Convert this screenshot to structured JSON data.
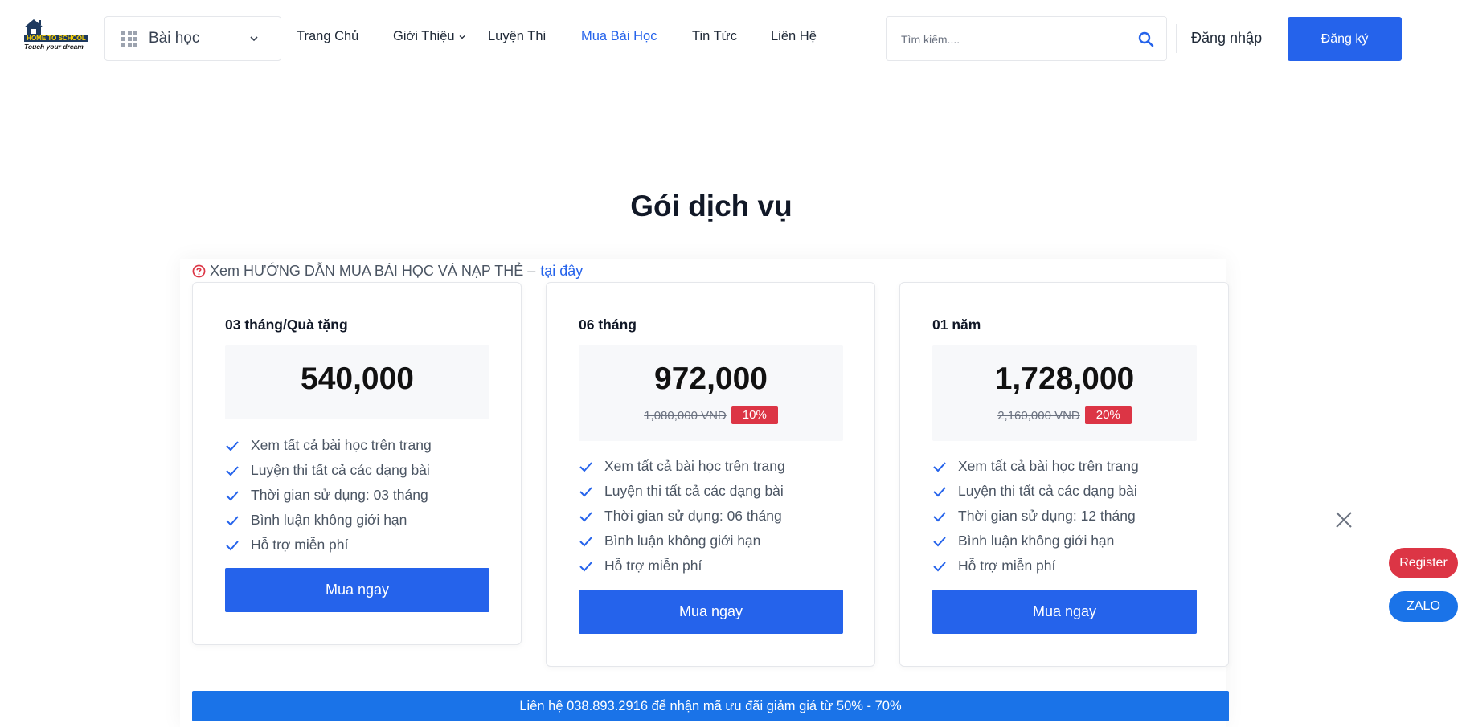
{
  "brand": {
    "logo_line1": "HOME TO SCHOOL",
    "logo_line2": "Touch your dream",
    "logo_icon": "house-icon"
  },
  "header": {
    "category_label": "Bài học",
    "nav": [
      {
        "label": "Trang Chủ",
        "active": false
      },
      {
        "label": "Giới Thiệu",
        "active": false,
        "has_dropdown": true
      },
      {
        "label": "Luyện Thi",
        "active": false
      },
      {
        "label": "Mua Bài Học",
        "active": true
      },
      {
        "label": "Tin Tức",
        "active": false
      },
      {
        "label": "Liên Hệ",
        "active": false
      }
    ],
    "search_placeholder": "Tìm kiếm....",
    "login_label": "Đăng nhập",
    "register_label": "Đăng ký"
  },
  "main": {
    "title": "Gói dịch vụ",
    "guide_text": "Xem HƯỚNG DẪN MUA BÀI HỌC VÀ NẠP THẺ –",
    "guide_link": "tại đây",
    "plans": [
      {
        "title": "03 tháng/Quà tặng",
        "price": "540,000",
        "old_price": "",
        "discount": "",
        "features": [
          "Xem tất cả bài học trên trang",
          "Luyện thi tất cả các dạng bài",
          "Thời gian sử dụng: 03 tháng",
          "Bình luận không giới hạn",
          "Hỗ trợ miễn phí"
        ],
        "button": "Mua ngay"
      },
      {
        "title": "06 tháng",
        "price": "972,000",
        "old_price": "1,080,000 VNĐ",
        "discount": "10%",
        "features": [
          "Xem tất cả bài học trên trang",
          "Luyện thi tất cả các dạng bài",
          "Thời gian sử dụng: 06 tháng",
          "Bình luận không giới hạn",
          "Hỗ trợ miễn phí"
        ],
        "button": "Mua ngay"
      },
      {
        "title": "01 năm",
        "price": "1,728,000",
        "old_price": "2,160,000 VNĐ",
        "discount": "20%",
        "features": [
          "Xem tất cả bài học trên trang",
          "Luyện thi tất cả các dạng bài",
          "Thời gian sử dụng: 12 tháng",
          "Bình luận không giới hạn",
          "Hỗ trợ miễn phí"
        ],
        "button": "Mua ngay"
      }
    ],
    "promo_text": "Liên hệ 038.893.2916 để nhận mã ưu đãi giảm giá từ 50% - 70%"
  },
  "floating": {
    "register_label": "Register",
    "zalo_label": "ZALO"
  },
  "colors": {
    "primary": "#2563eb",
    "danger": "#dc3545",
    "promo": "#1a73e8"
  }
}
